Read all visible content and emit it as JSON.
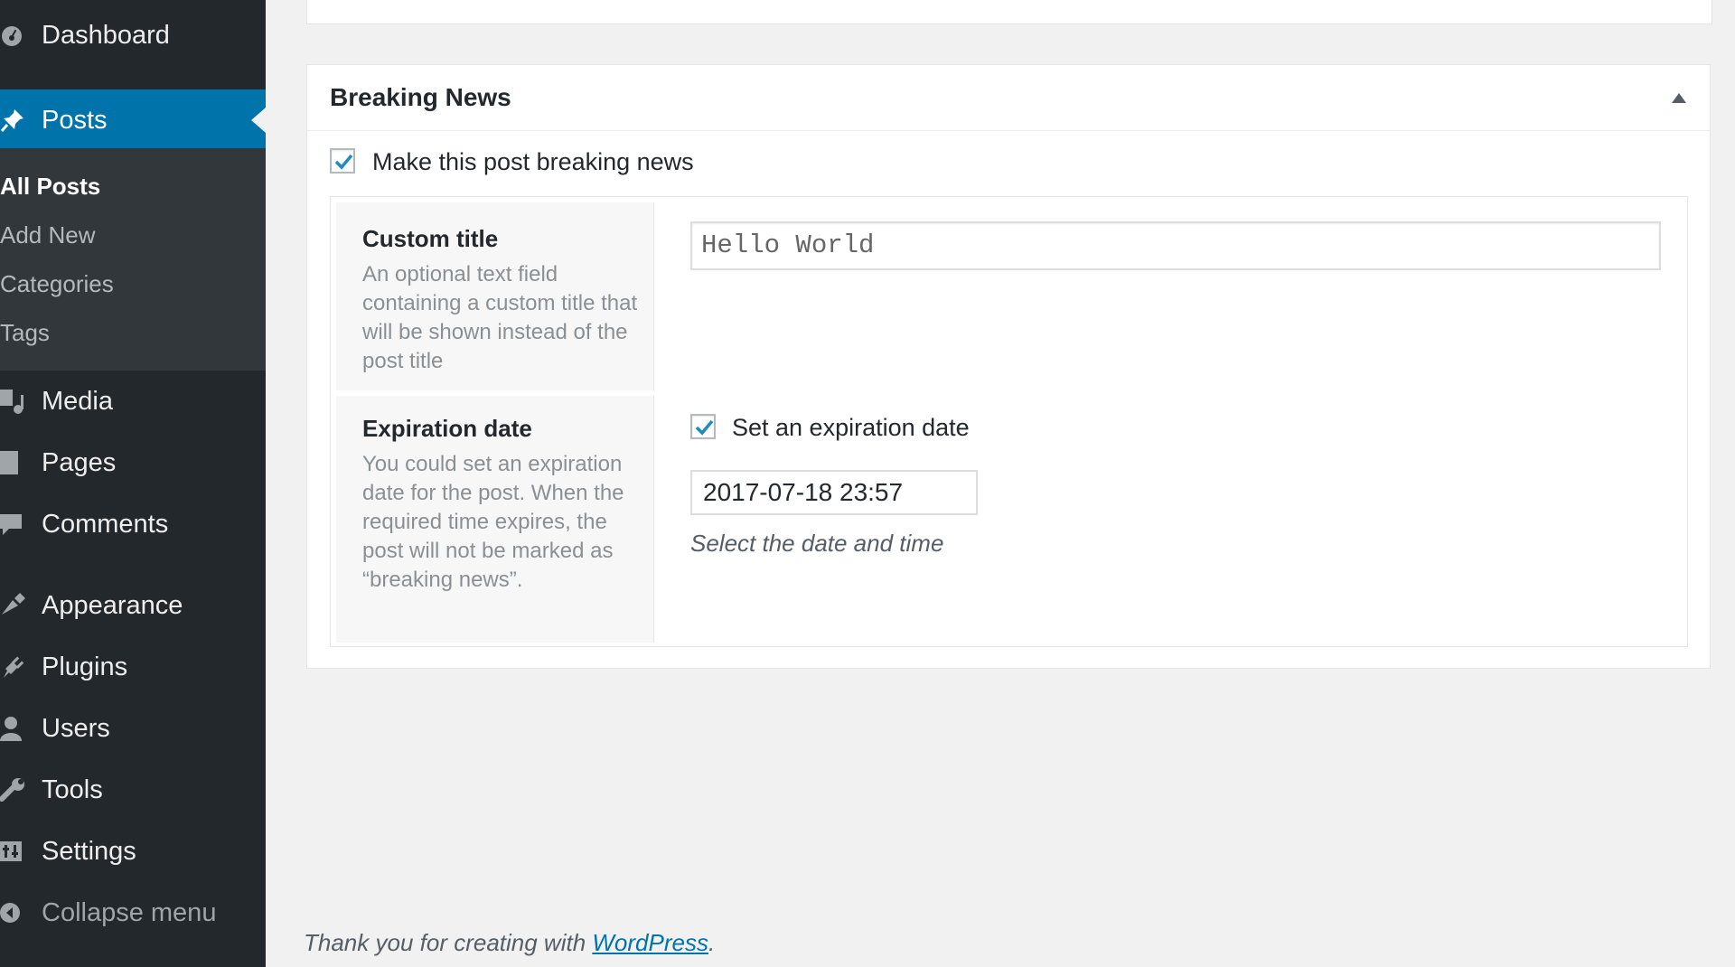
{
  "sidebar": {
    "dashboard": "Dashboard",
    "posts": "Posts",
    "submenu": [
      "All Posts",
      "Add New",
      "Categories",
      "Tags"
    ],
    "items": [
      "Media",
      "Pages",
      "Comments",
      "Appearance",
      "Plugins",
      "Users",
      "Tools",
      "Settings"
    ],
    "collapse": "Collapse menu"
  },
  "metabox": {
    "title": "Breaking News",
    "breaking_checkbox_label": "Make this post breaking news",
    "breaking_checked": true,
    "custom_title": {
      "label": "Custom title",
      "description": "An optional text field containing a custom title that will be shown instead of the post title",
      "value": "Hello World"
    },
    "expiration": {
      "label": "Expiration date",
      "description": "You could set an expiration date for the post. When the required time expires, the post will not be marked as “breaking news”.",
      "checkbox_label": "Set an expiration date",
      "checked": true,
      "value": "2017-07-18 23:57",
      "hint": "Select the date and time"
    }
  },
  "footer": {
    "prefix": "Thank you for creating with ",
    "link": "WordPress",
    "suffix": "."
  },
  "colors": {
    "sidebar_bg": "#23282d",
    "submenu_bg": "#32373c",
    "accent": "#0073aa",
    "checkmark": "#1e8cbe"
  }
}
